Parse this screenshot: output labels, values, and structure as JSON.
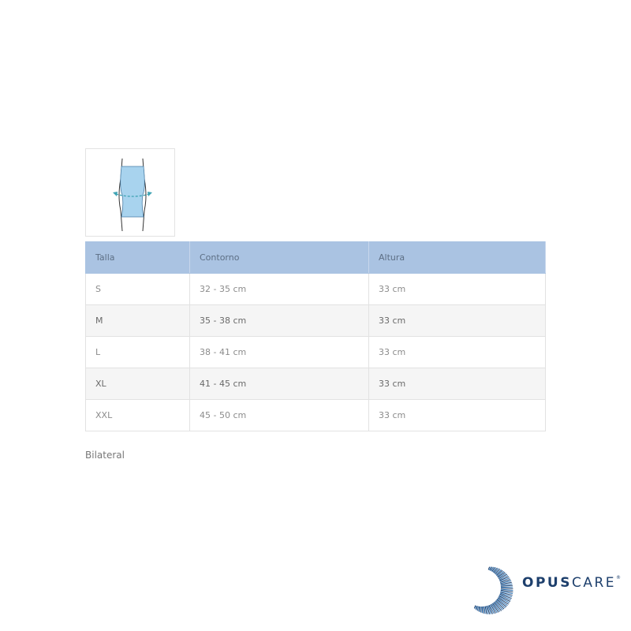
{
  "table": {
    "headers": [
      "Talla",
      "Contorno",
      "Altura"
    ],
    "rows": [
      [
        "S",
        "32 - 35 cm",
        "33 cm"
      ],
      [
        "M",
        "35 - 38 cm",
        "33 cm"
      ],
      [
        "L",
        "38 - 41 cm",
        "33 cm"
      ],
      [
        "XL",
        "41 - 45 cm",
        "33 cm"
      ],
      [
        "XXL",
        "45 - 50 cm",
        "33 cm"
      ]
    ]
  },
  "note": "Bilateral",
  "brand": {
    "bold": "OPUS",
    "light": "CARE",
    "mark": "®"
  },
  "colors": {
    "header_bg": "#aac3e2",
    "brace": "#a8d3ee",
    "brand": "#1d3f6c",
    "arrow": "#3fa3b4"
  }
}
